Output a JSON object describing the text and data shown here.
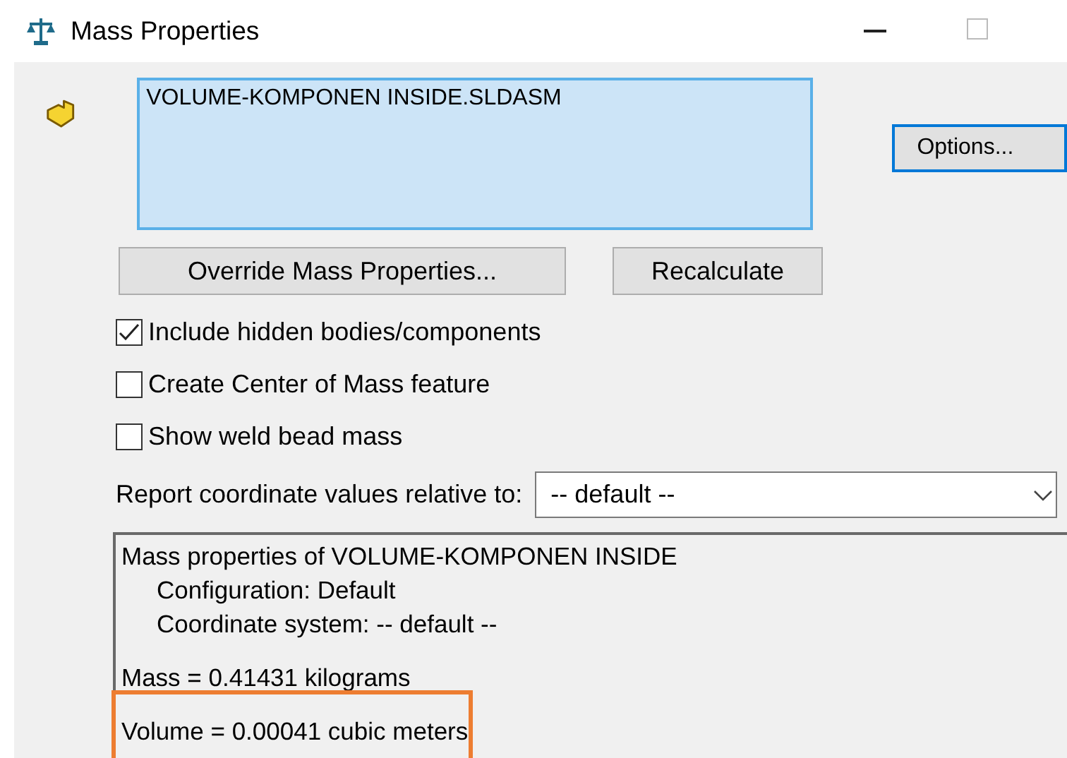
{
  "window": {
    "title": "Mass Properties"
  },
  "selection": {
    "items": [
      "VOLUME-KOMPONEN INSIDE.SLDASM"
    ]
  },
  "options_button": "Options...",
  "buttons": [
    "Override Mass Properties...",
    "Recalculate"
  ],
  "checkboxes": [
    {
      "label": "Include hidden bodies/components",
      "checked": true
    },
    {
      "label": "Create Center of Mass feature",
      "checked": false
    },
    {
      "label": "Show weld bead mass",
      "checked": false
    }
  ],
  "coordinate": {
    "label": "Report coordinate values relative to:",
    "value": "-- default --"
  },
  "report": [
    {
      "text": "Mass properties of VOLUME-KOMPONEN INSIDE",
      "kind": "plain",
      "spaced": false,
      "highlighted": false
    },
    {
      "text": "Configuration: Default",
      "kind": "indent",
      "spaced": false,
      "highlighted": false
    },
    {
      "text": "Coordinate system: -- default --",
      "kind": "indent",
      "spaced": false,
      "highlighted": false
    },
    {
      "text": "Mass = 0.41431 kilograms",
      "kind": "plain",
      "spaced": true,
      "highlighted": false
    },
    {
      "text": "Volume = 0.00041 cubic meters",
      "kind": "plain",
      "spaced": true,
      "highlighted": true
    }
  ]
}
